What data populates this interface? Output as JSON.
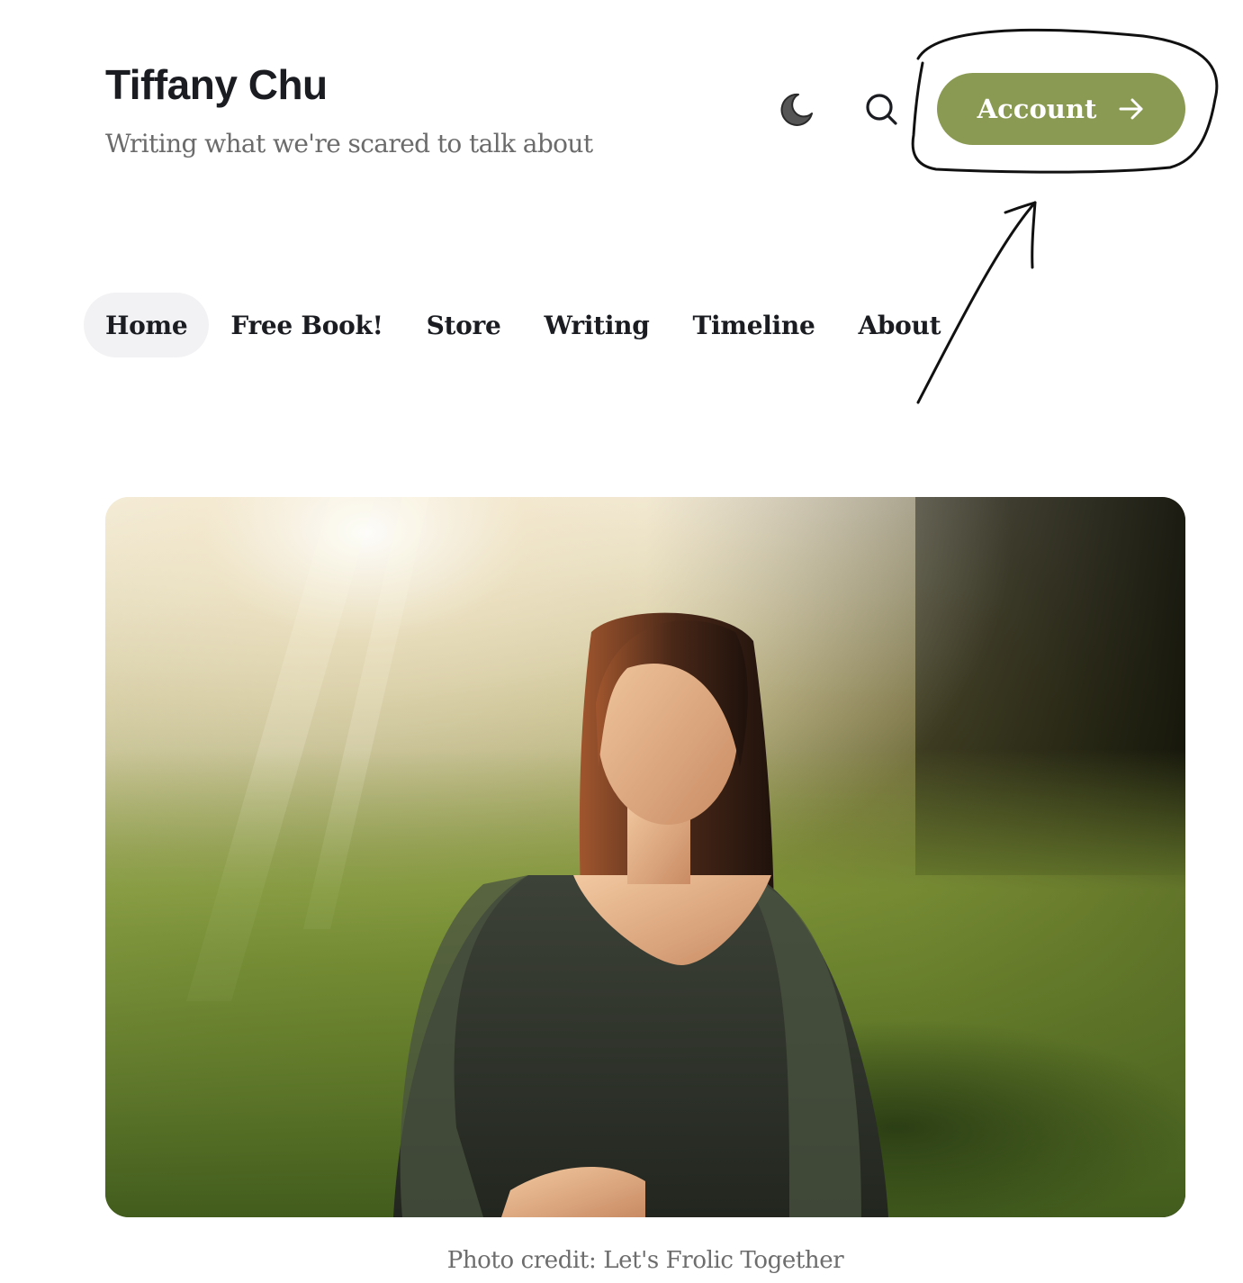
{
  "header": {
    "site_title": "Tiffany Chu",
    "tagline": "Writing what we're scared to talk about",
    "theme_toggle_icon": "moon-icon",
    "search_icon": "search-icon",
    "account_label": "Account",
    "account_icon": "arrow-right-icon",
    "accent_color": "#8a9a52"
  },
  "nav": {
    "items": [
      {
        "label": "Home",
        "active": true
      },
      {
        "label": "Free Book!"
      },
      {
        "label": "Store"
      },
      {
        "label": "Writing"
      },
      {
        "label": "Timeline"
      },
      {
        "label": "About"
      }
    ]
  },
  "hero": {
    "image_subject": "woman sitting in sunlit grass field"
  },
  "caption": {
    "text": "Photo credit: Let's Frolic Together"
  }
}
